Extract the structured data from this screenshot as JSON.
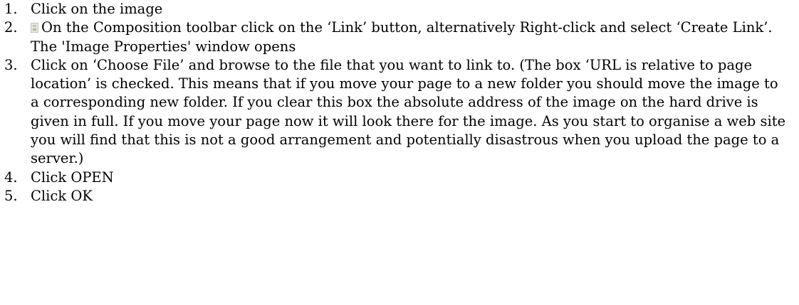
{
  "steps": [
    {
      "number": "1.",
      "text": "Click on the image"
    },
    {
      "number": "2.",
      "icon": "link-button-icon",
      "text": "On the Composition toolbar click on the ‘Link’ button, alternatively Right-click and select ‘Create Link’. The 'Image Properties' window opens"
    },
    {
      "number": "3.",
      "text": "Click on ‘Choose File’ and browse to the file that you want to link to. (The box ‘URL is relative to page location’ is checked. This means that if you move your page to a new folder you should move the image to a corresponding new folder. If you clear this box the absolute address of the image on the hard drive is given in full. If you move your page now it will look there for the image. As you start to organise a web site you will find that this is not a good arrangement and potentially disastrous when you upload the page to a server.)"
    },
    {
      "number": "4.",
      "text": "Click OPEN"
    },
    {
      "number": "5.",
      "text": "Click OK"
    }
  ]
}
